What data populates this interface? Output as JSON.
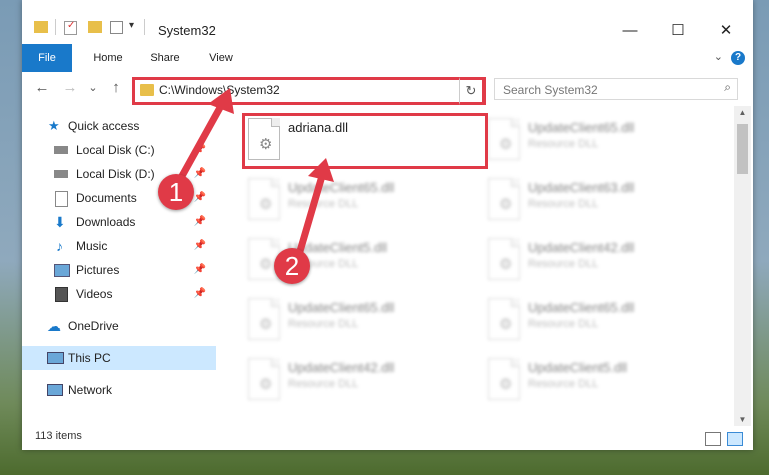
{
  "window": {
    "title": "System32",
    "controls": {
      "minimize": "—",
      "maximize": "☐",
      "close": "✕"
    }
  },
  "ribbon": {
    "tabs": [
      {
        "label": "File"
      },
      {
        "label": "Home"
      },
      {
        "label": "Share"
      },
      {
        "label": "View"
      }
    ],
    "help": "?"
  },
  "navbar": {
    "back": "←",
    "forward": "→",
    "recent": "⌄",
    "up": "↑",
    "address": "C:\\Windows\\System32",
    "refresh": "↻",
    "search_placeholder": "Search System32"
  },
  "sidebar": {
    "items": [
      {
        "label": "Quick access",
        "icon": "star-icon"
      },
      {
        "label": "Local Disk (C:)",
        "icon": "drive-icon",
        "pinned": true
      },
      {
        "label": "Local Disk (D:)",
        "icon": "drive-icon",
        "pinned": true
      },
      {
        "label": "Documents",
        "icon": "documents-icon",
        "pinned": true
      },
      {
        "label": "Downloads",
        "icon": "downloads-icon",
        "pinned": true
      },
      {
        "label": "Music",
        "icon": "music-icon",
        "pinned": true
      },
      {
        "label": "Pictures",
        "icon": "pictures-icon",
        "pinned": true
      },
      {
        "label": "Videos",
        "icon": "videos-icon",
        "pinned": true
      },
      {
        "label": "OneDrive",
        "icon": "cloud-icon"
      },
      {
        "label": "This PC",
        "icon": "computer-icon",
        "selected": true
      },
      {
        "label": "Network",
        "icon": "network-icon"
      }
    ]
  },
  "files": [
    {
      "name": "adriana.dll",
      "type": ""
    },
    {
      "name": "UpdateClient65.dll",
      "type": "Resource DLL"
    },
    {
      "name": "UpdateClient65.dll",
      "type": "Resource DLL"
    },
    {
      "name": "UpdateClient63.dll",
      "type": "Resource DLL"
    },
    {
      "name": "UpdateClient5.dll",
      "type": "Resource DLL"
    },
    {
      "name": "UpdateClient42.dll",
      "type": "Resource DLL"
    },
    {
      "name": "UpdateClient65.dll",
      "type": "Resource DLL"
    },
    {
      "name": "UpdateClient65.dll",
      "type": "Resource DLL"
    },
    {
      "name": "UpdateClient42.dll",
      "type": "Resource DLL"
    },
    {
      "name": "UpdateClient5.dll",
      "type": "Resource DLL"
    }
  ],
  "status": {
    "item_count": "113 items"
  },
  "callouts": [
    "1",
    "2"
  ],
  "colors": {
    "accent": "#1979ca",
    "annotation": "#e03a47",
    "selected": "#cce8ff"
  }
}
